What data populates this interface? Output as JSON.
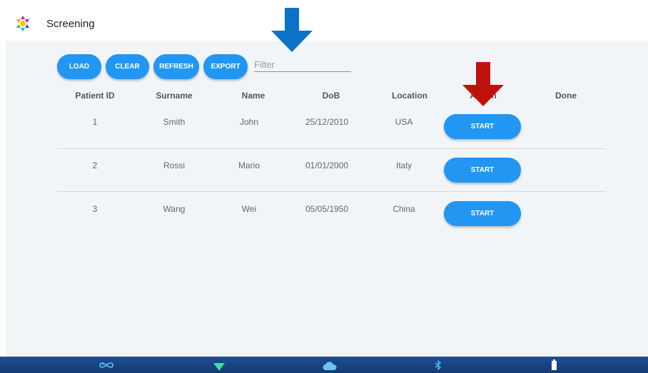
{
  "app": {
    "title": "Screening",
    "logo_icon": "multicolor-star-logo"
  },
  "toolbar": {
    "load_label": "LOAD",
    "clear_label": "CLEAR",
    "refresh_label": "REFRESH",
    "export_label": "EXPORT",
    "filter_value": "",
    "filter_placeholder": "Filter"
  },
  "table": {
    "columns": [
      "Patient ID",
      "Surname",
      "Name",
      "DoB",
      "Location",
      "Action",
      "Done"
    ],
    "rows": [
      {
        "id": "1",
        "surname": "Smith",
        "name": "John",
        "dob": "25/12/2010",
        "location": "USA",
        "action_label": "START",
        "done": ""
      },
      {
        "id": "2",
        "surname": "Rossi",
        "name": "Mario",
        "dob": "01/01/2000",
        "location": "Italy",
        "action_label": "START",
        "done": ""
      },
      {
        "id": "3",
        "surname": "Wang",
        "name": "Wei",
        "dob": "05/05/1950",
        "location": "China",
        "action_label": "START",
        "done": ""
      }
    ]
  },
  "annotations": {
    "blue_arrow": "down-arrow-blue",
    "red_arrow": "down-arrow-red",
    "blue_color": "#0b72c8",
    "red_color": "#c0120c"
  },
  "statusbar": {
    "icons": [
      "infinity-icon",
      "wifi-icon",
      "cloud-icon",
      "bluetooth-icon",
      "battery-icon"
    ]
  },
  "colors": {
    "accent": "#2196f3",
    "content_bg": "#f1f5f7",
    "statusbar_bg": "#1e4d92"
  }
}
